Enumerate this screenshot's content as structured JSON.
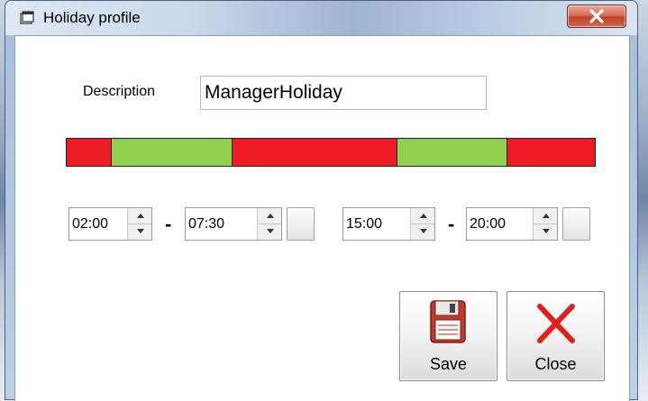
{
  "window": {
    "title": "Holiday profile"
  },
  "form": {
    "description_label": "Description",
    "description_value": "ManagerHoliday"
  },
  "timeline": {
    "range_hours": [
      0,
      24
    ],
    "segments": [
      {
        "from": "00:00",
        "to": "02:00",
        "color": "#ed1c24",
        "active": false
      },
      {
        "from": "02:00",
        "to": "07:30",
        "color": "#92d050",
        "active": true
      },
      {
        "from": "07:30",
        "to": "15:00",
        "color": "#ed1c24",
        "active": false
      },
      {
        "from": "15:00",
        "to": "20:00",
        "color": "#92d050",
        "active": true
      },
      {
        "from": "20:00",
        "to": "24:00",
        "color": "#ed1c24",
        "active": false
      }
    ]
  },
  "periods": [
    {
      "start": "02:00",
      "separator": "-",
      "end": "07:30"
    },
    {
      "start": "15:00",
      "separator": "-",
      "end": "20:00"
    }
  ],
  "buttons": {
    "save": {
      "label": "Save",
      "icon": "floppy-disk-icon"
    },
    "close": {
      "label": "Close",
      "icon": "red-x-icon"
    }
  },
  "colors": {
    "active": "#92d050",
    "inactive": "#ed1c24"
  }
}
